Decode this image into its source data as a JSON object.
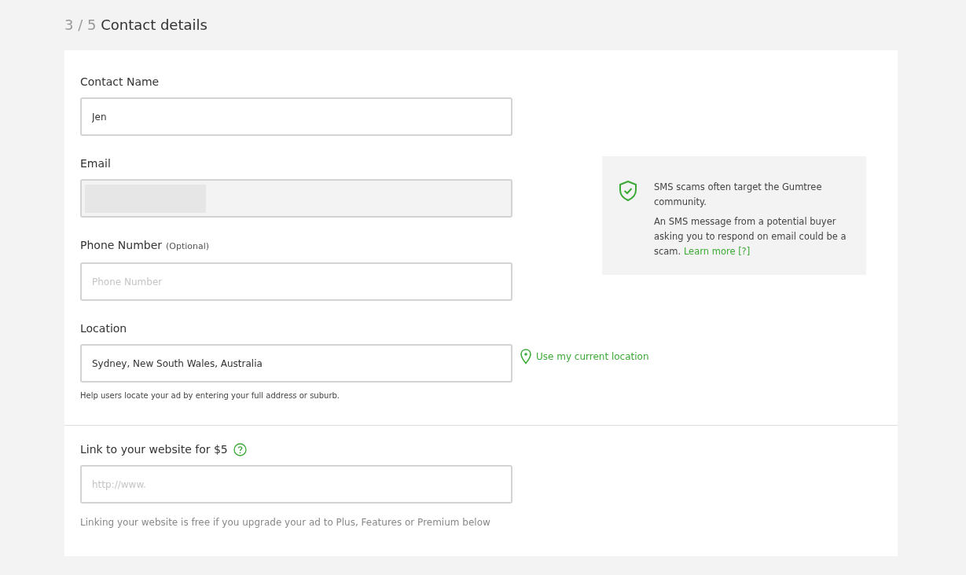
{
  "heading": {
    "step": "3 / 5",
    "title": "Contact details"
  },
  "fields": [
    {
      "label": "Contact Name",
      "value": "Jen",
      "disabled": false
    },
    {
      "label": "Email",
      "disabled": true,
      "redacted": true
    },
    {
      "label": "Phone Number",
      "optional": "(Optional)",
      "placeholder": "Phone Number",
      "disabled": false
    }
  ],
  "notice": {
    "title": "SMS scams often target the Gumtree community.",
    "body": "An SMS message from a potential buyer asking you to respond on email could be a scam.",
    "link": "Learn more [?]"
  },
  "location": {
    "label": "Location",
    "value": "Sydney, New South Wales, Australia",
    "action": "Use my current location",
    "help": "Help users locate your ad by entering your full address or suburb."
  },
  "website": {
    "label": "Link to your website for $5",
    "placeholder": "http://www.",
    "note": "Linking your website is free if you upgrade your ad to Plus, Features or Premium below"
  }
}
